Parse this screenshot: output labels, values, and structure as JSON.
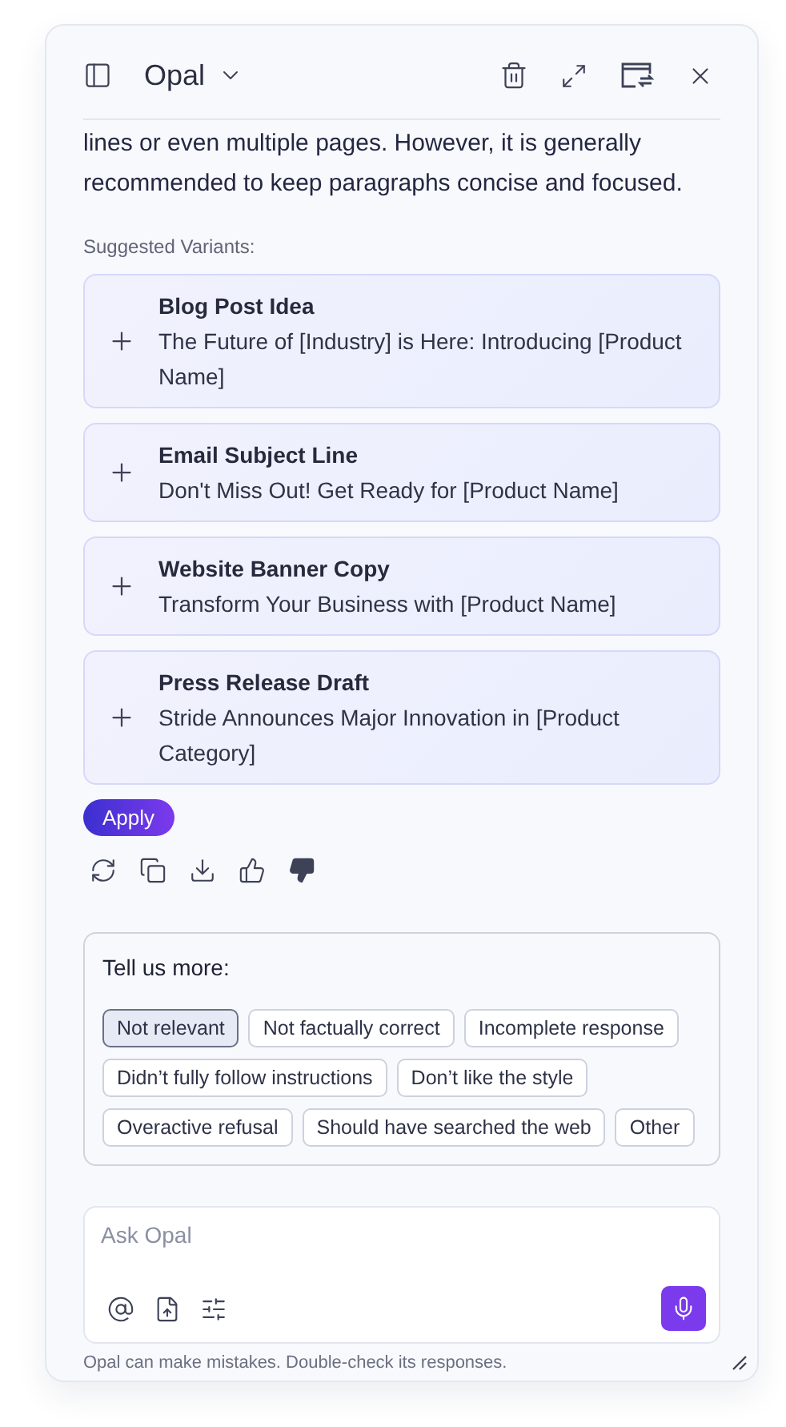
{
  "header": {
    "title": "Opal"
  },
  "message": {
    "text": "lines or even multiple pages. However, it is generally recommended to keep paragraphs concise and focused."
  },
  "variants_label": "Suggested Variants:",
  "variants": [
    {
      "title": "Blog Post Idea",
      "text": "The Future of [Industry] is Here: Introducing [Product Name]"
    },
    {
      "title": "Email Subject Line",
      "text": "Don't Miss Out! Get Ready for [Product Name]"
    },
    {
      "title": "Website Banner Copy",
      "text": "Transform Your Business with [Product Name]"
    },
    {
      "title": "Press Release Draft",
      "text": "Stride Announces Major Innovation in [Product Category]"
    }
  ],
  "apply_button": "Apply",
  "actions": [
    {
      "kind": "regenerate",
      "selected": false
    },
    {
      "kind": "copy",
      "selected": false
    },
    {
      "kind": "download",
      "selected": false
    },
    {
      "kind": "like",
      "selected": false
    },
    {
      "kind": "dislike",
      "selected": true
    }
  ],
  "feedback": {
    "title": "Tell us more:",
    "options": [
      {
        "label": "Not relevant",
        "selected": true
      },
      {
        "label": "Not factually correct",
        "selected": false
      },
      {
        "label": "Incomplete response",
        "selected": false
      },
      {
        "label": "Didn’t fully follow instructions",
        "selected": false
      },
      {
        "label": "Don’t like the style",
        "selected": false
      },
      {
        "label": "Overactive refusal",
        "selected": false
      },
      {
        "label": "Should have searched the web",
        "selected": false
      },
      {
        "label": "Other",
        "selected": false
      }
    ]
  },
  "composer": {
    "placeholder": "Ask Opal"
  },
  "disclaimer": "Opal can make mistakes. Double-check its responses."
}
